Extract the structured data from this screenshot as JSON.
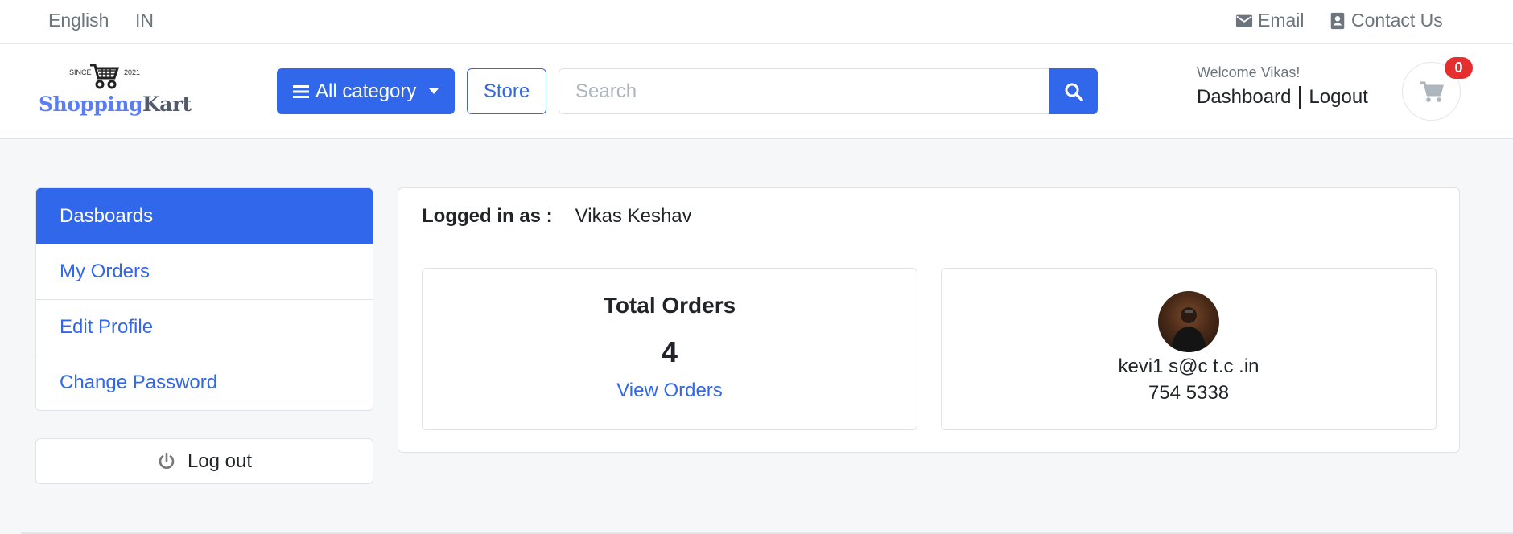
{
  "topbar": {
    "language": "English",
    "region": "IN",
    "email_label": "Email",
    "contact_label": "Contact Us"
  },
  "header": {
    "logo": {
      "since": "SINCE",
      "year": "2021",
      "brand_part1": "Shopping",
      "brand_part2": "Kart"
    },
    "category_button": "All category",
    "store_button": "Store",
    "search": {
      "placeholder": "Search",
      "value": ""
    },
    "welcome": "Welcome Vikas!",
    "dashboard_link": "Dashboard",
    "logout_link": "Logout",
    "cart_count": "0"
  },
  "sidebar": {
    "items": [
      {
        "label": "Dasboards",
        "active": true
      },
      {
        "label": "My Orders",
        "active": false
      },
      {
        "label": "Edit Profile",
        "active": false
      },
      {
        "label": "Change Password",
        "active": false
      }
    ],
    "logout_label": "Log out"
  },
  "main": {
    "logged_in_label": "Logged in as :",
    "user_name": "Vikas Keshav",
    "orders_card": {
      "title": "Total Orders",
      "count": "4",
      "link": "View Orders"
    },
    "profile_card": {
      "email": "kevi1 s@c    t.c .in",
      "phone": "754    5338"
    }
  },
  "colors": {
    "primary": "#3167eb",
    "badge": "#e62e2e",
    "muted": "#6c757d"
  }
}
